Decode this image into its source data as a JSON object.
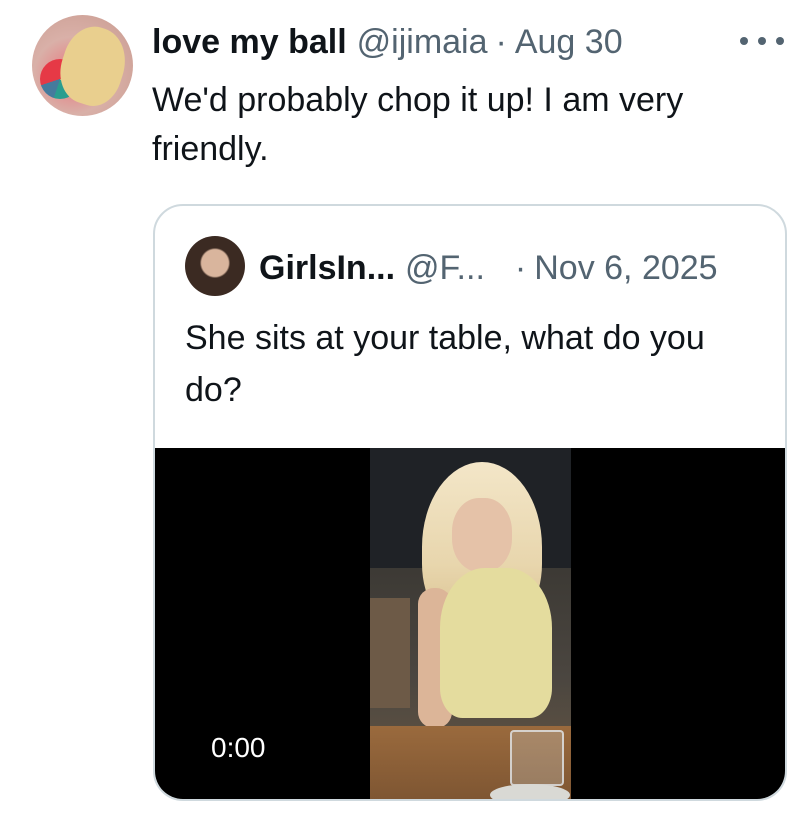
{
  "tweet": {
    "author_name": "love my ball",
    "author_handle": "@ijimaia",
    "separator": "·",
    "date": "Aug 30",
    "more_label": "More",
    "text": "We'd probably chop it up! I am very friendly."
  },
  "quote": {
    "author_name": "GirlsIn...",
    "author_handle": "@F...",
    "separator": "·",
    "date": "Nov 6, 2025",
    "text": "She sits at your table, what do you do?",
    "video": {
      "time": "0:00"
    }
  },
  "colors": {
    "text_primary": "#0f1419",
    "text_secondary": "#536471",
    "border": "#cfd9de",
    "video_bg": "#000000"
  },
  "icons": {
    "more": "more-horizontal-icon"
  }
}
